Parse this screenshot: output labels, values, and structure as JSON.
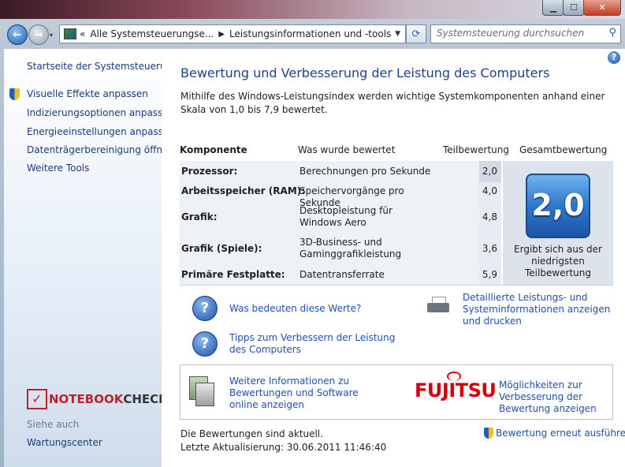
{
  "window": {
    "minimize": "▁",
    "maximize": "☐",
    "close": "✕"
  },
  "nav": {
    "back": "←",
    "forward": "→",
    "dropdown": "▾",
    "breadcrumb_prefix": "«",
    "breadcrumb": [
      "Alle Systemsteuerungse...",
      "Leistungsinformationen und -tools"
    ],
    "breadcrumb_sep": "▶",
    "address_dropdown": "▼",
    "refresh": "⟳",
    "search_placeholder": "Systemsteuerung durchsuchen",
    "search_icon": "⚲"
  },
  "sidebar": {
    "home": "Startseite der Systemsteuerung",
    "items": [
      "Visuelle Effekte anpassen",
      "Indizierungsoptionen anpassen",
      "Energieeinstellungen anpassen",
      "Datenträgerbereinigung öffnen",
      "Weitere Tools"
    ],
    "logo": {
      "mark": "✓",
      "part1": "NOTEBOOK",
      "part2": "CHECK"
    },
    "see_also_label": "Siehe auch",
    "see_also_items": [
      "Wartungscenter"
    ]
  },
  "main": {
    "help": "?",
    "title": "Bewertung und Verbesserung der Leistung des Computers",
    "description": "Mithilfe des Windows-Leistungsindex werden wichtige Systemkomponenten anhand einer Skala von 1,0 bis 7,9 bewertet.",
    "table": {
      "headers": {
        "component": "Komponente",
        "rated": "Was wurde bewertet",
        "subscore": "Teilbewertung",
        "basescore": "Gesamtbewertung"
      },
      "rows": [
        {
          "component": "Prozessor:",
          "rated": "Berechnungen pro Sekunde",
          "subscore": "2,0"
        },
        {
          "component": "Arbeitsspeicher (RAM):",
          "rated": "Speichervorgänge pro Sekunde",
          "subscore": "4,0"
        },
        {
          "component": "Grafik:",
          "rated": "Desktopleistung für Windows Aero",
          "subscore": "4,8"
        },
        {
          "component": "Grafik (Spiele):",
          "rated": "3D-Business- und Gaminggrafikleistung",
          "subscore": "3,6"
        },
        {
          "component": "Primäre Festplatte:",
          "rated": "Datentransferrate",
          "subscore": "5,9"
        }
      ],
      "base_score": "2,0",
      "base_score_caption": "Ergibt sich aus der niedrigsten Teilbewertung"
    },
    "links": {
      "what_mean": "Was bedeuten diese Werte?",
      "tips": "Tipps zum Verbessern der Leistung des Computers",
      "detailed": "Detaillierte Leistungs- und Systeminformationen anzeigen und drucken",
      "help_icon": "?"
    },
    "info_box": {
      "software_link": "Weitere Informationen zu Bewertungen und Software online anzeigen",
      "vendor_logo": "FUJITSU",
      "vendor_link": "Möglichkeiten zur Verbesserung der Bewertung anzeigen"
    },
    "status": {
      "line1": "Die Bewertungen sind aktuell.",
      "line2": "Letzte Aktualisierung: 30.06.2011 11:46:40"
    },
    "rerun": "Bewertung erneut ausführen"
  }
}
